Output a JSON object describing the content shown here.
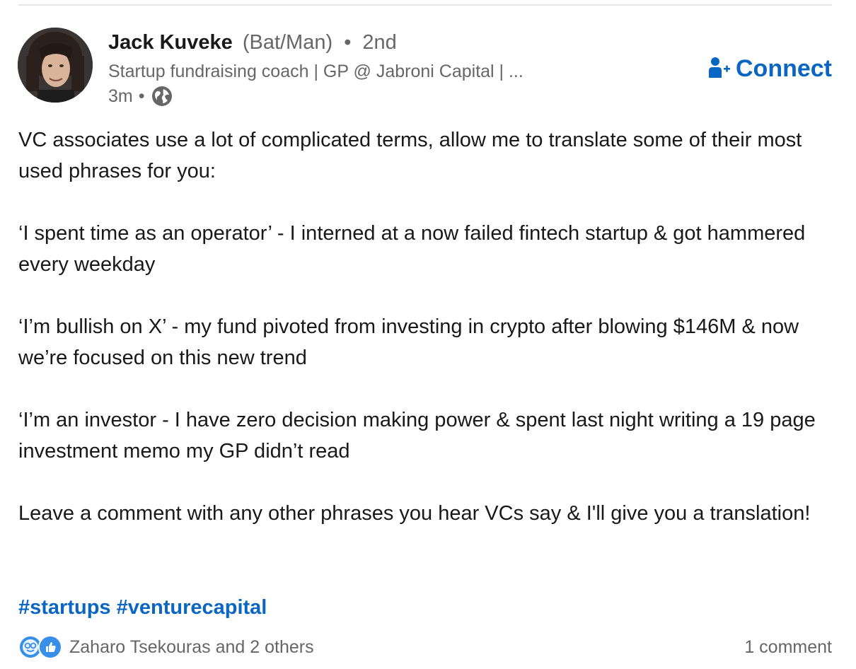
{
  "post": {
    "author": {
      "name": "Jack Kuveke",
      "pronouns": "(Bat/Man)",
      "separator": "•",
      "degree": "2nd",
      "headline": "Startup fundraising coach | GP @ Jabroni Capital | ...",
      "time": "3m",
      "visibility_icon": "globe-icon"
    },
    "connect_label": "Connect",
    "connect_icon": "person-add-icon",
    "body": [
      "VC associates use a lot of complicated terms, allow me to translate some of their most used phrases for you:",
      "‘I spent time as an operator’ - I interned at a now failed fintech startup & got hammered every weekday",
      "‘I’m bullish on X’ - my fund pivoted from investing in crypto after blowing $146M & now we’re focused on this new trend",
      "‘I’m an investor - I have zero decision making power & spent last night writing a 19 page investment memo my GP didn’t read",
      "Leave a comment with any other phrases you hear VCs say & I'll give you a translation!"
    ],
    "hashtags": [
      "#startups",
      "#venturecapital"
    ],
    "reactions": {
      "icons": [
        "insightful-icon",
        "like-icon"
      ],
      "summary": "Zaharo Tsekouras and 2 others"
    },
    "comments_label": "1 comment"
  },
  "colors": {
    "link_blue": "#0a66c2",
    "text_primary": "#191919",
    "text_secondary": "#666666",
    "divider": "#e6e6e6"
  }
}
